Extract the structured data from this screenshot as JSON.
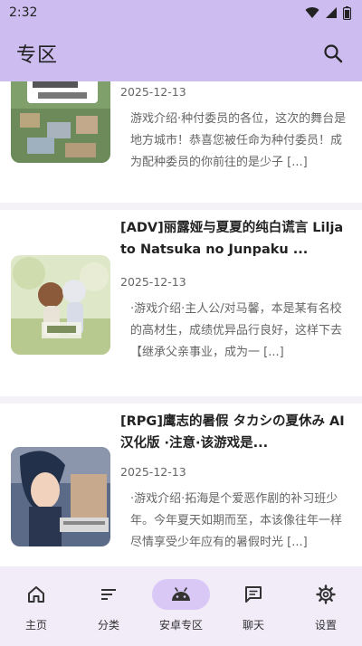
{
  "status": {
    "time": "2:32"
  },
  "app_bar": {
    "title": "专区"
  },
  "cards": [
    {
      "date": "2025-12-13",
      "description": "游戏介绍·种付委员的各位，这次的舞台是地方城市！恭喜您被任命为种付委员！成为配种委员的你前往的是少子 [...]"
    },
    {
      "title": "[ADV]丽露娅与夏夏的纯白谎言 Lilja to Natsuka no Junpaku ...",
      "date": "2025-12-13",
      "description": "·游戏介绍·主人公/对马馨，本是某有名校的高材生，成绩优异品行良好，这样下去【继承父亲事业，成为一 [...]"
    },
    {
      "title": "[RPG]鹰志的暑假 タカシの夏休み AI汉化版 ·注意·该游戏是...",
      "date": "2025-12-13",
      "description": "·游戏介绍·拓海是个爱恶作剧的补习班少年。今年夏天如期而至，本该像往年一样尽情享受少年应有的暑假时光 [...]"
    }
  ],
  "nav": [
    {
      "label": "主页",
      "icon": "home-icon"
    },
    {
      "label": "分类",
      "icon": "sort-icon"
    },
    {
      "label": "安卓专区",
      "icon": "android-icon",
      "active": true
    },
    {
      "label": "聊天",
      "icon": "chat-icon"
    },
    {
      "label": "设置",
      "icon": "settings-icon"
    }
  ]
}
